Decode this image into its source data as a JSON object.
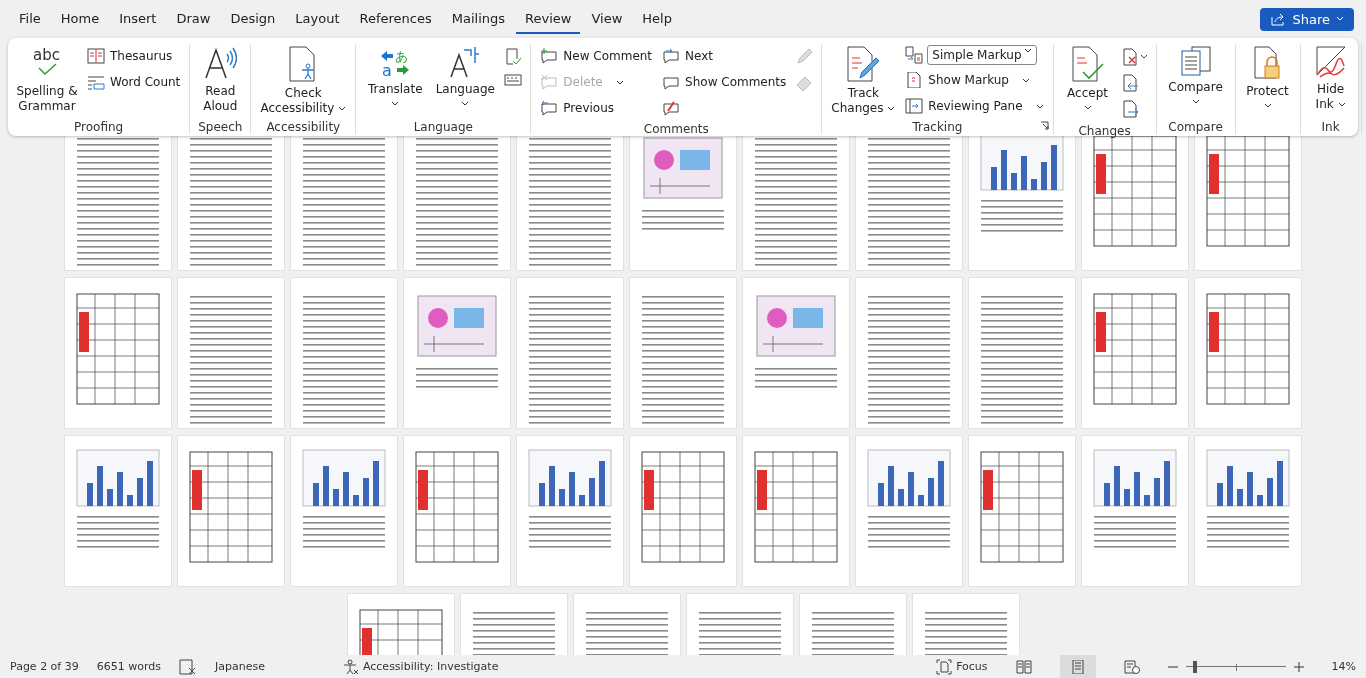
{
  "menu_tabs": [
    {
      "label": "File",
      "selected": false
    },
    {
      "label": "Home",
      "selected": false
    },
    {
      "label": "Insert",
      "selected": false
    },
    {
      "label": "Draw",
      "selected": false
    },
    {
      "label": "Design",
      "selected": false
    },
    {
      "label": "Layout",
      "selected": false
    },
    {
      "label": "References",
      "selected": false
    },
    {
      "label": "Mailings",
      "selected": false
    },
    {
      "label": "Review",
      "selected": true
    },
    {
      "label": "View",
      "selected": false
    },
    {
      "label": "Help",
      "selected": false
    }
  ],
  "share_button": {
    "label": "Share"
  },
  "ribbon": {
    "groups": [
      {
        "label": "Proofing",
        "items": [
          {
            "label": "Spelling & Grammar",
            "icon_text": "abc",
            "disabled": false
          },
          {
            "label": "Thesaurus",
            "disabled": false
          },
          {
            "label": "Word Count",
            "disabled": false
          }
        ]
      },
      {
        "label": "Speech",
        "items": [
          {
            "label": "Read Aloud",
            "disabled": false
          }
        ]
      },
      {
        "label": "Accessibility",
        "items": [
          {
            "label": "Check Accessibility",
            "disabled": false
          }
        ]
      },
      {
        "label": "Language",
        "items": [
          {
            "label": "Translate",
            "icon_text": [
              "a",
              "あ"
            ],
            "disabled": false
          },
          {
            "label": "Language",
            "disabled": false
          }
        ]
      },
      {
        "label": "Comments",
        "items": [
          {
            "label": "New Comment",
            "disabled": false
          },
          {
            "label": "Delete",
            "disabled": true
          },
          {
            "label": "Previous",
            "disabled": false
          },
          {
            "label": "Next",
            "disabled": false
          },
          {
            "label": "Show Comments",
            "disabled": false
          }
        ]
      },
      {
        "label": "Tracking",
        "markup_select": {
          "value": "Simple Markup"
        },
        "items": [
          {
            "label": "Track Changes",
            "disabled": false
          },
          {
            "label": "Show Markup",
            "disabled": false
          },
          {
            "label": "Reviewing Pane",
            "disabled": false
          }
        ]
      },
      {
        "label": "Changes",
        "items": [
          {
            "label": "Accept",
            "disabled": false
          }
        ]
      },
      {
        "label": "Compare",
        "items": [
          {
            "label": "Compare",
            "disabled": false
          }
        ]
      },
      {
        "items": [
          {
            "label": "Protect",
            "disabled": false
          }
        ]
      },
      {
        "label": "Ink",
        "items": [
          {
            "label": "Hide Ink",
            "disabled": false
          }
        ]
      }
    ]
  },
  "pages": [
    {
      "kind": "text"
    },
    {
      "kind": "text"
    },
    {
      "kind": "text"
    },
    {
      "kind": "text"
    },
    {
      "kind": "text"
    },
    {
      "kind": "diagram"
    },
    {
      "kind": "text"
    },
    {
      "kind": "text"
    },
    {
      "kind": "chart"
    },
    {
      "kind": "table"
    },
    {
      "kind": "table"
    },
    {
      "kind": "table"
    },
    {
      "kind": "text"
    },
    {
      "kind": "text"
    },
    {
      "kind": "diagram"
    },
    {
      "kind": "text"
    },
    {
      "kind": "text"
    },
    {
      "kind": "diagram"
    },
    {
      "kind": "text"
    },
    {
      "kind": "text"
    },
    {
      "kind": "table"
    },
    {
      "kind": "table"
    },
    {
      "kind": "chart"
    },
    {
      "kind": "table"
    },
    {
      "kind": "chart"
    },
    {
      "kind": "table"
    },
    {
      "kind": "chart"
    },
    {
      "kind": "table"
    },
    {
      "kind": "table"
    },
    {
      "kind": "chart"
    },
    {
      "kind": "table"
    },
    {
      "kind": "chart"
    },
    {
      "kind": "chart"
    },
    {
      "kind": "table"
    },
    {
      "kind": "text"
    },
    {
      "kind": "text"
    },
    {
      "kind": "text"
    },
    {
      "kind": "text"
    },
    {
      "kind": "text"
    }
  ],
  "status_bar": {
    "page": "Page 2 of 39",
    "words": "6651 words",
    "language": "Japanese",
    "accessibility": "Accessibility: Investigate",
    "focus": "Focus",
    "views": [
      {
        "selected": false
      },
      {
        "selected": true
      },
      {
        "selected": false
      }
    ],
    "zoom": {
      "level": 0.07,
      "reading": "14%"
    }
  }
}
